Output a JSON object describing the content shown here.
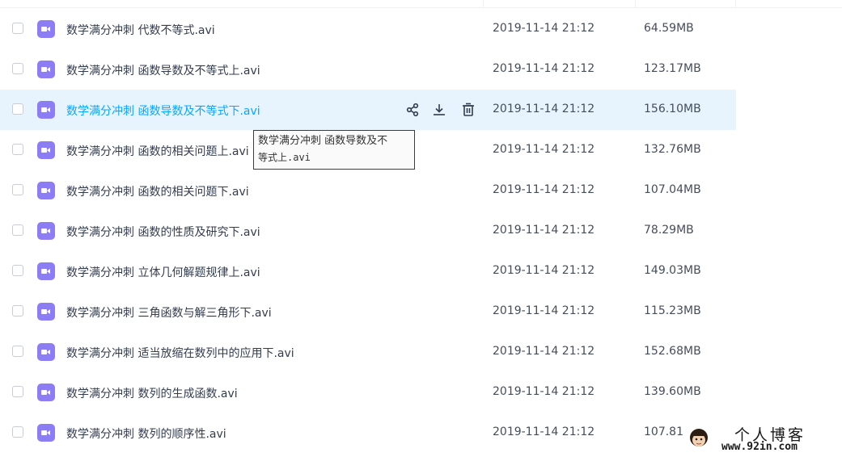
{
  "files": [
    {
      "name": "数学满分冲刺 代数不等式.avi",
      "date": "2019-11-14 21:12",
      "size": "64.59MB"
    },
    {
      "name": "数学满分冲刺 函数导数及不等式上.avi",
      "date": "2019-11-14 21:12",
      "size": "123.17MB"
    },
    {
      "name": "数学满分冲刺 函数导数及不等式下.avi",
      "date": "2019-11-14 21:12",
      "size": "156.10MB"
    },
    {
      "name": "数学满分冲刺 函数的相关问题上.avi",
      "date": "2019-11-14 21:12",
      "size": "132.76MB"
    },
    {
      "name": "数学满分冲刺 函数的相关问题下.avi",
      "date": "2019-11-14 21:12",
      "size": "107.04MB"
    },
    {
      "name": "数学满分冲刺 函数的性质及研究下.avi",
      "date": "2019-11-14 21:12",
      "size": "78.29MB"
    },
    {
      "name": "数学满分冲刺 立体几何解题规律上.avi",
      "date": "2019-11-14 21:12",
      "size": "149.03MB"
    },
    {
      "name": "数学满分冲刺 三角函数与解三角形下.avi",
      "date": "2019-11-14 21:12",
      "size": "115.23MB"
    },
    {
      "name": "数学满分冲刺 适当放缩在数列中的应用下.avi",
      "date": "2019-11-14 21:12",
      "size": "152.68MB"
    },
    {
      "name": "数学满分冲刺 数列的生成函数.avi",
      "date": "2019-11-14 21:12",
      "size": "139.60MB"
    },
    {
      "name": "数学满分冲刺 数列的顺序性.avi",
      "date": "2019-11-14 21:12",
      "size": "107.81"
    }
  ],
  "hovered_index": 2,
  "row_actions": [
    "share-icon",
    "download-icon",
    "delete-icon"
  ],
  "tooltip": {
    "line1": "数学满分冲刺 函数导数及不",
    "line2": "等式上.avi"
  },
  "watermark": {
    "title": "个人博客",
    "url": "www.92in.com"
  },
  "colors": {
    "hover_bg": "#e7f4fd",
    "hover_text": "#06a7ff",
    "video_icon": "#8c7df4",
    "text": "#333c4e"
  }
}
